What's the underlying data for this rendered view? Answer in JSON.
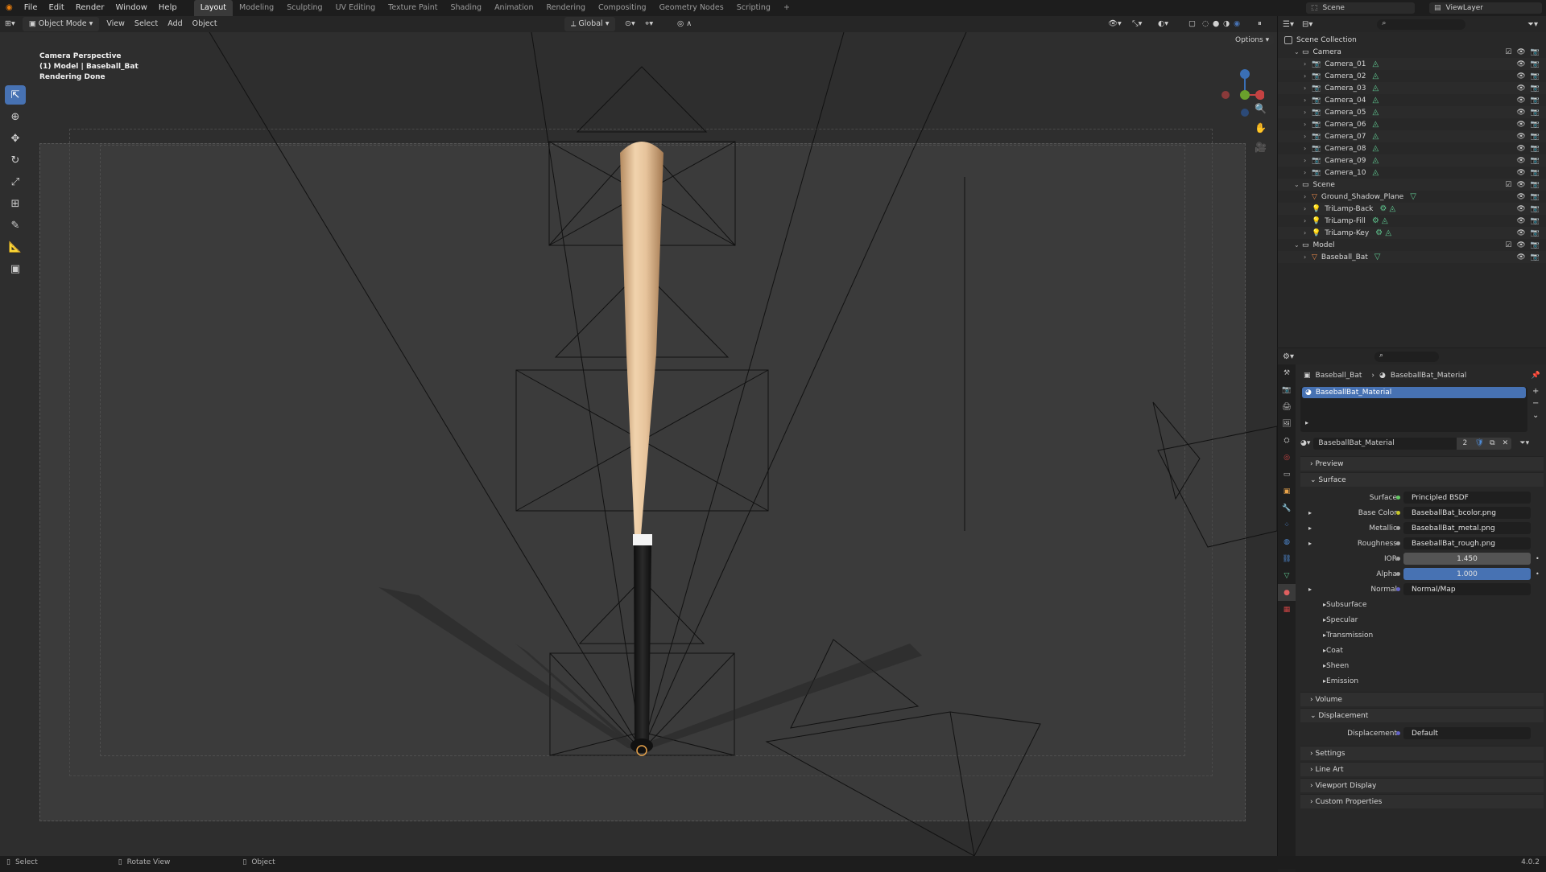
{
  "topbar": {
    "menus": [
      "File",
      "Edit",
      "Render",
      "Window",
      "Help"
    ],
    "workspaces": [
      "Layout",
      "Modeling",
      "Sculpting",
      "UV Editing",
      "Texture Paint",
      "Shading",
      "Animation",
      "Rendering",
      "Compositing",
      "Geometry Nodes",
      "Scripting"
    ],
    "active_workspace": "Layout",
    "scene": "Scene",
    "view_layer": "ViewLayer"
  },
  "header": {
    "mode": "Object Mode",
    "view": "View",
    "select": "Select",
    "add": "Add",
    "object": "Object",
    "orientation": "Global",
    "options": "Options"
  },
  "viewport": {
    "line1": "Camera Perspective",
    "line2": "(1) Model | Baseball_Bat",
    "line3": "Rendering Done"
  },
  "outliner": {
    "root": "Scene Collection",
    "rows": [
      {
        "label": "Camera",
        "kind": "collection",
        "indent": 1
      },
      {
        "label": "Camera_01",
        "kind": "camera",
        "indent": 2
      },
      {
        "label": "Camera_02",
        "kind": "camera",
        "indent": 2
      },
      {
        "label": "Camera_03",
        "kind": "camera",
        "indent": 2
      },
      {
        "label": "Camera_04",
        "kind": "camera",
        "indent": 2
      },
      {
        "label": "Camera_05",
        "kind": "camera",
        "indent": 2
      },
      {
        "label": "Camera_06",
        "kind": "camera",
        "indent": 2
      },
      {
        "label": "Camera_07",
        "kind": "camera",
        "indent": 2
      },
      {
        "label": "Camera_08",
        "kind": "camera",
        "indent": 2
      },
      {
        "label": "Camera_09",
        "kind": "camera",
        "indent": 2
      },
      {
        "label": "Camera_10",
        "kind": "camera",
        "indent": 2
      },
      {
        "label": "Scene",
        "kind": "collection",
        "indent": 1
      },
      {
        "label": "Ground_Shadow_Plane",
        "kind": "mesh",
        "indent": 2
      },
      {
        "label": "TriLamp-Back",
        "kind": "light",
        "indent": 2
      },
      {
        "label": "TriLamp-Fill",
        "kind": "light",
        "indent": 2
      },
      {
        "label": "TriLamp-Key",
        "kind": "light",
        "indent": 2
      },
      {
        "label": "Model",
        "kind": "collection",
        "indent": 1
      },
      {
        "label": "Baseball_Bat",
        "kind": "mesh",
        "indent": 2
      }
    ]
  },
  "properties": {
    "breadcrumb_object": "Baseball_Bat",
    "breadcrumb_material": "BaseballBat_Material",
    "slot_name": "BaseballBat_Material",
    "material_name": "BaseballBat_Material",
    "users": "2",
    "panels": {
      "preview": "Preview",
      "surface": "Surface",
      "volume": "Volume",
      "displacement": "Displacement",
      "settings": "Settings",
      "line_art": "Line Art",
      "viewport_display": "Viewport Display",
      "custom_properties": "Custom Properties"
    },
    "surface_fields": [
      {
        "label": "Surface",
        "value": "Principled BSDF",
        "dot": "#63c763",
        "style": "text"
      },
      {
        "label": "Base Color",
        "value": "BaseballBat_bcolor.png",
        "dot": "#c7c729",
        "style": "text"
      },
      {
        "label": "Metallic",
        "value": "BaseballBat_metal.png",
        "dot": "#a1a1a1",
        "style": "text"
      },
      {
        "label": "Roughness",
        "value": "BaseballBat_rough.png",
        "dot": "#a1a1a1",
        "style": "text"
      },
      {
        "label": "IOR",
        "value": "1.450",
        "dot": "#a1a1a1",
        "style": "num"
      },
      {
        "label": "Alpha",
        "value": "1.000",
        "dot": "#a1a1a1",
        "style": "blue"
      },
      {
        "label": "Normal",
        "value": "Normal/Map",
        "dot": "#6363c7",
        "style": "text"
      }
    ],
    "subpanels": [
      "Subsurface",
      "Specular",
      "Transmission",
      "Coat",
      "Sheen",
      "Emission"
    ],
    "displacement_label": "Displacement",
    "displacement_value": "Default"
  },
  "statusbar": {
    "select": "Select",
    "rotate": "Rotate View",
    "object": "Object",
    "version": "4.0.2"
  },
  "colors": {
    "accent": "#4772b3",
    "bat_wood": "#e9c59a",
    "bat_handle": "#1f1f1f"
  }
}
